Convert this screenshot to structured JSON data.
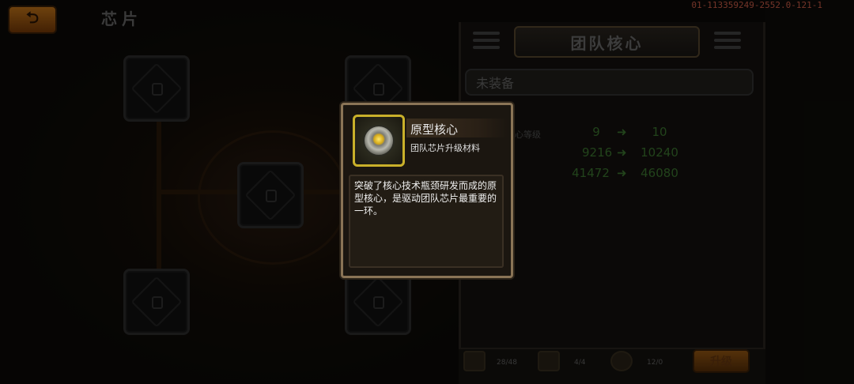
{
  "app": {
    "page_title": "芯片",
    "back_label": "⮌",
    "debug_id": "01-113359249-2552.0-121-1"
  },
  "panel": {
    "header_title": "团队核心",
    "status": "未装备",
    "stats": [
      {
        "label": "核心等级",
        "from": "9",
        "to": "10"
      },
      {
        "label": "",
        "from": "9216",
        "to": "10240"
      },
      {
        "label": "",
        "from": "41472",
        "to": "46080"
      }
    ],
    "materials": [
      {
        "icon": "chip-material-icon",
        "count": "28/48"
      },
      {
        "icon": "card-material-icon",
        "count": "4/4"
      },
      {
        "icon": "core-material-icon",
        "count": "12/0"
      }
    ],
    "upgrade_label": "升级"
  },
  "tooltip": {
    "item_name": "原型核心",
    "item_type": "团队芯片升级材料",
    "item_icon": "prototype-core-icon",
    "description": "突破了核心技术瓶颈研发而成的原型核心，是驱动团队芯片最重要的一环。"
  },
  "colors": {
    "accent_orange": "#c8781a",
    "tooltip_border": "#8a7456",
    "icon_gold": "#c9b02a",
    "stat_green": "#3e7a32",
    "debug_red": "#d3604a"
  }
}
